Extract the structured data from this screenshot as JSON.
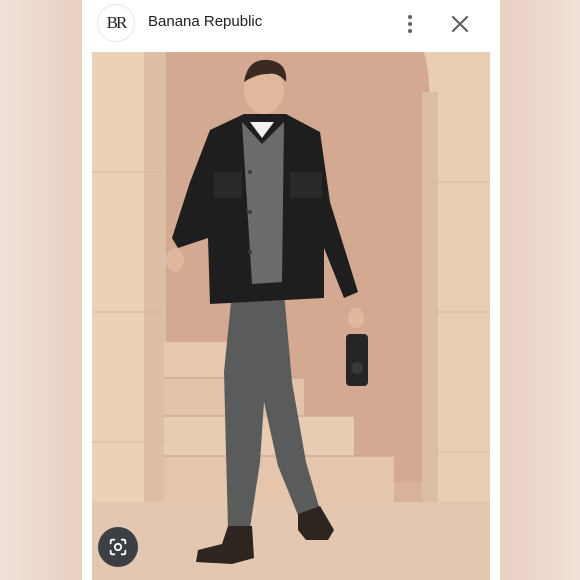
{
  "header": {
    "logo_text": "BR",
    "brand_name": "Banana Republic",
    "menu_icon": "more-vert-icon",
    "close_icon": "close-icon"
  },
  "image": {
    "description_icon": "product-photo",
    "lens_icon": "lens-search-icon"
  },
  "colors": {
    "background": "#e9d3c6",
    "panel": "#ffffff",
    "lens_button": "#3c3f43"
  }
}
